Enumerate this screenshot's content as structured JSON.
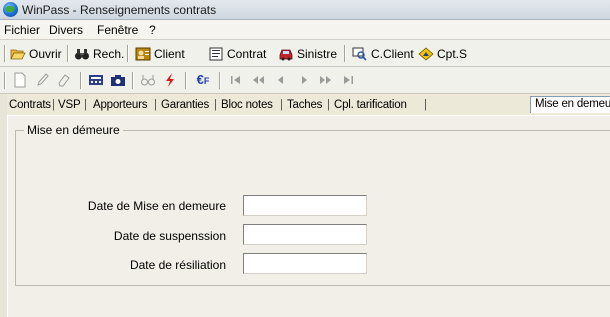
{
  "window": {
    "title": "WinPass - Renseignements contrats"
  },
  "menu": [
    "Fichier",
    "Divers",
    "Fenêtre",
    "?"
  ],
  "toolbar": {
    "open": "Ouvrir",
    "search": "Rech.",
    "client": "Client",
    "contract": "Contrat",
    "claim": "Sinistre",
    "c_client": "C.Client",
    "cpt": "Cpt.S"
  },
  "toolbar2_icons": [
    "new-doc-icon",
    "edit-icon",
    "eraser-icon",
    "calculator-icon",
    "camera-icon",
    "binoculars-icon",
    "lightning-icon",
    "euro-icon",
    "first-icon",
    "rewind-icon",
    "prev-icon",
    "next-icon",
    "fast-forward-icon",
    "last-icon"
  ],
  "tabs": [
    "Contrats",
    "VSP",
    "Apporteurs",
    "Garanties",
    "Bloc notes",
    "Taches",
    "Cpl. tarification",
    "Mise en demeure"
  ],
  "active_tab": "Mise en demeure",
  "group": {
    "title": "Mise en démeure",
    "fields": [
      {
        "label": "Date de Mise en demeure",
        "value": ""
      },
      {
        "label": "Date de suspenssion",
        "value": ""
      },
      {
        "label": "Date de résiliation",
        "value": ""
      }
    ]
  }
}
